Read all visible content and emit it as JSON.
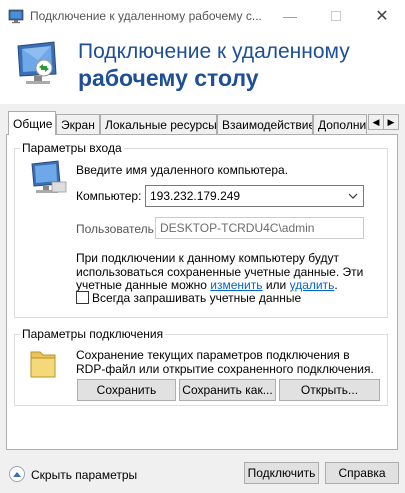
{
  "window": {
    "title": "Подключение к удаленному рабочему с..."
  },
  "banner": {
    "line1": "Подключение к удаленному",
    "line2": "рабочему столу"
  },
  "tabs": [
    {
      "label": "Общие",
      "active": true
    },
    {
      "label": "Экран"
    },
    {
      "label": "Локальные ресурсы"
    },
    {
      "label": "Взаимодействие"
    },
    {
      "label": "Дополни"
    }
  ],
  "logon": {
    "group_title": "Параметры входа",
    "prompt": "Введите имя удаленного компьютера.",
    "computer_label": "Компьютер:",
    "computer_value": "193.232.179.249",
    "user_label": "Пользователь:",
    "user_value": "DESKTOP-TCRDU4C\\admin",
    "info_line1": "При подключении к данному компьютеру будут",
    "info_line2": "использоваться сохраненные учетные данные.  Эти",
    "info_line3_prefix": "учетные данные можно ",
    "edit_link": "изменить",
    "info_or": " или ",
    "delete_link": "удалить",
    "info_end": ".",
    "always_ask_label": "Всегда запрашивать учетные данные",
    "always_ask_checked": false
  },
  "connection": {
    "group_title": "Параметры подключения",
    "desc_line1": "Сохранение текущих параметров подключения в",
    "desc_line2": "RDP-файл или открытие сохраненного подключения.",
    "save_button": "Сохранить",
    "save_as_button": "Сохранить как...",
    "open_button": "Открыть..."
  },
  "footer": {
    "hide_options": "Скрыть параметры",
    "connect_button": "Подключить",
    "help_button": "Справка"
  },
  "colors": {
    "banner_text": "#1f4e99",
    "link": "#0066cc",
    "body_bg": "#f0f0f0"
  }
}
